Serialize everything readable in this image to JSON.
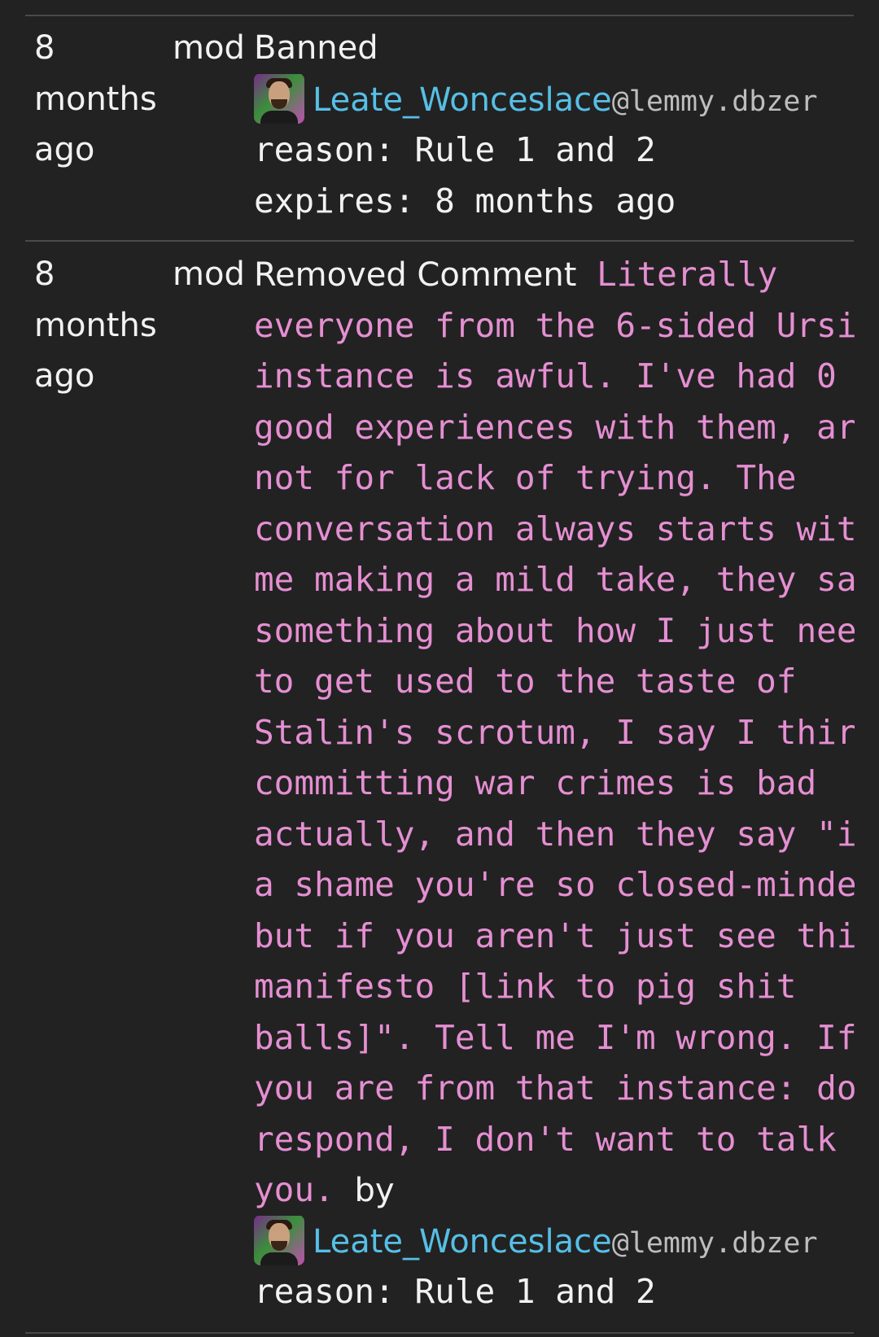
{
  "colors": {
    "background": "#222222",
    "text": "#f2f2f2",
    "comment_text": "#e58fd2",
    "user_link": "#56bfe6",
    "instance_text": "#bdbdbd",
    "divider": "#4a4a4a"
  },
  "entries": [
    {
      "time_lines": [
        "8",
        "months",
        "ago"
      ],
      "moderator": "mod",
      "action": "Banned",
      "user": {
        "name": "Leate_Wonceslace",
        "instance": "@lemmy.dbzer",
        "avatar_icon": "user-avatar-icon"
      },
      "reason": "reason: Rule 1 and 2",
      "expires": "expires: 8 months ago"
    },
    {
      "time_lines": [
        "8",
        "months",
        "ago"
      ],
      "moderator": "mod",
      "action": "Removed Comment",
      "comment_first_line": "Literally",
      "comment_lines": [
        "everyone from the 6-sided Ursi",
        "instance is awful. I've had 0",
        "good experiences with them, ar",
        "not for lack of trying. The",
        "conversation always starts wit",
        "me making a mild take, they sa",
        "something about how I just nee",
        "to get used to the taste of",
        "Stalin's scrotum, I say I thir",
        "committing war crimes is bad",
        "actually, and then they say \"i",
        "a shame you're so closed-minde",
        "but if you aren't just see thi",
        "manifesto [link to pig shit",
        "balls]\". Tell me I'm wrong. If",
        "you are from that instance: do",
        "respond, I don't want to talk"
      ],
      "comment_last_line": "you.",
      "by_label": "by",
      "user": {
        "name": "Leate_Wonceslace",
        "instance": "@lemmy.dbzer",
        "avatar_icon": "user-avatar-icon"
      },
      "reason": "reason: Rule 1 and 2"
    }
  ]
}
